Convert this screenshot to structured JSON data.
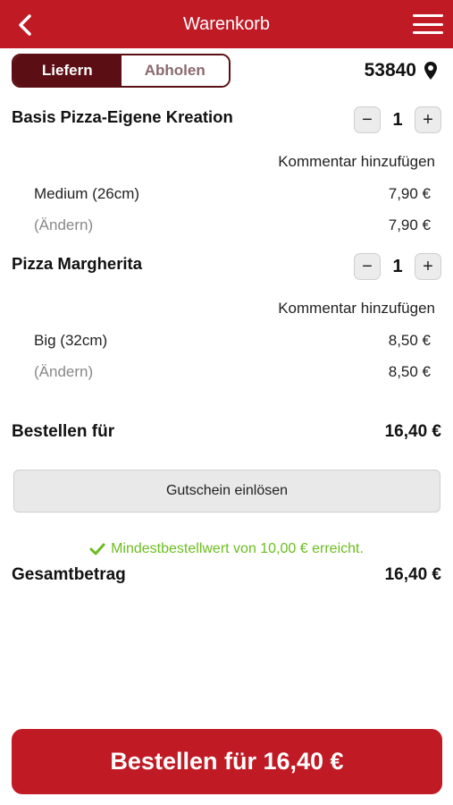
{
  "header": {
    "title": "Warenkorb",
    "back_icon": "chevron-left-icon",
    "menu_icon": "hamburger-menu-icon",
    "bg_color": "#c01a25"
  },
  "delivery_toggle": {
    "options": [
      "Liefern",
      "Abholen"
    ],
    "selected": "Liefern"
  },
  "location": {
    "postal_code": "53840",
    "icon": "map-pin-icon"
  },
  "cart_items": [
    {
      "name": "Basis Pizza-Eigene Kreation",
      "quantity": "1",
      "minus_label": "−",
      "plus_label": "+",
      "comment_label": "Kommentar hinzufügen",
      "size": "Medium (26cm)",
      "size_price": "7,90 €",
      "change_label": "(Ändern)",
      "total_price": "7,90 €"
    },
    {
      "name": "Pizza Margherita",
      "quantity": "1",
      "minus_label": "−",
      "plus_label": "+",
      "comment_label": "Kommentar hinzufügen",
      "size": "Big (32cm)",
      "size_price": "8,50 €",
      "change_label": "(Ändern)",
      "total_price": "8,50 €"
    }
  ],
  "subtotal": {
    "label": "Bestellen für",
    "value": "16,40 €"
  },
  "voucher_button": "Gutschein einlösen",
  "min_order_message": "Mindestbestellwert von 10,00 € erreicht.",
  "min_order_color": "#6cbd1f",
  "total": {
    "label": "Gesamtbetrag",
    "value": "16,40 €"
  },
  "order_button": "Bestellen für 16,40 €"
}
